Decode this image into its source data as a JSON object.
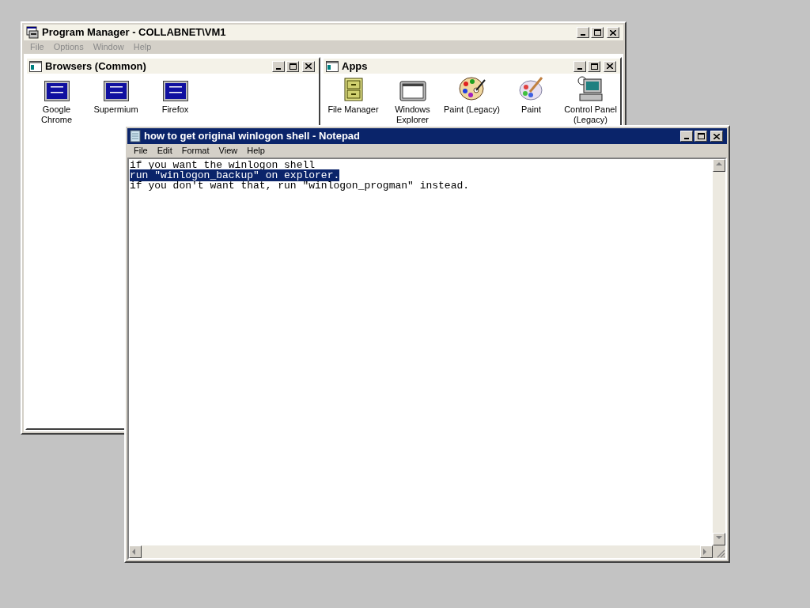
{
  "program_manager": {
    "title": "Program Manager - COLLABNET\\VM1",
    "active": false,
    "menu": [
      {
        "label": "File",
        "disabled": true
      },
      {
        "label": "Options",
        "disabled": true
      },
      {
        "label": "Window",
        "disabled": true
      },
      {
        "label": "Help",
        "disabled": true
      }
    ],
    "groups": [
      {
        "title": "Browsers (Common)",
        "active": false,
        "items": [
          {
            "label": "Google Chrome",
            "kind": "msdos"
          },
          {
            "label": "Supermium",
            "kind": "msdos"
          },
          {
            "label": "Firefox",
            "kind": "msdos"
          }
        ]
      },
      {
        "title": "Apps",
        "active": false,
        "items": [
          {
            "label": "File Manager",
            "kind": "cabinet"
          },
          {
            "label": "Windows Explorer",
            "kind": "window"
          },
          {
            "label": "Paint (Legacy)",
            "kind": "palette"
          },
          {
            "label": "Paint",
            "kind": "brush"
          },
          {
            "label": "Control Panel (Legacy)",
            "kind": "computer"
          }
        ]
      }
    ]
  },
  "notepad": {
    "title": "how to get original winlogon shell - Notepad",
    "active": true,
    "menu": [
      {
        "label": "File",
        "disabled": false
      },
      {
        "label": "Edit",
        "disabled": false
      },
      {
        "label": "Format",
        "disabled": false
      },
      {
        "label": "View",
        "disabled": false
      },
      {
        "label": "Help",
        "disabled": false
      }
    ],
    "lines": [
      {
        "text": "if you want the winlogon shell",
        "selected": false
      },
      {
        "text": "run \"winlogon_backup\" on explorer.",
        "selected": true
      },
      {
        "text": "if you don't want that, run \"winlogon_progman\" instead.",
        "selected": false
      }
    ]
  }
}
